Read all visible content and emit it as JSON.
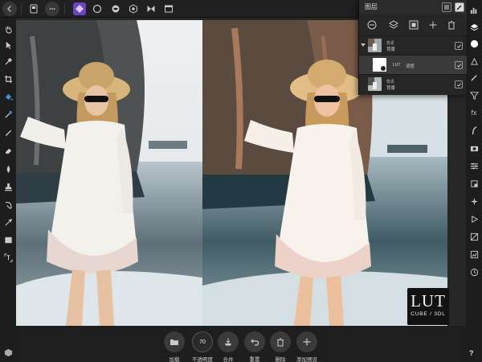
{
  "layers_panel": {
    "title": "图层",
    "layers": [
      {
        "type_label": "像素",
        "name": "背景"
      },
      {
        "type_label": "LUT",
        "name": "调整"
      },
      {
        "type_label": "像素",
        "name": "背景"
      }
    ]
  },
  "lut_badge": {
    "title": "LUT",
    "subtitle": "CUBE / 3DL"
  },
  "context_toolbar": {
    "opacity_value": "70",
    "buttons": [
      {
        "label": "加载",
        "icon": "folder-icon"
      },
      {
        "label": "不透明度",
        "icon": "opacity-dial-icon"
      },
      {
        "label": "合并",
        "icon": "merge-icon"
      },
      {
        "label": "重置",
        "icon": "reset-icon"
      },
      {
        "label": "删除",
        "icon": "trash-icon"
      },
      {
        "label": "添加预设",
        "icon": "plus-icon"
      }
    ]
  },
  "help_label": "?",
  "colors": {
    "accent": "#7b4ec9",
    "background": "#1c1c1c",
    "panel": "#262626"
  }
}
